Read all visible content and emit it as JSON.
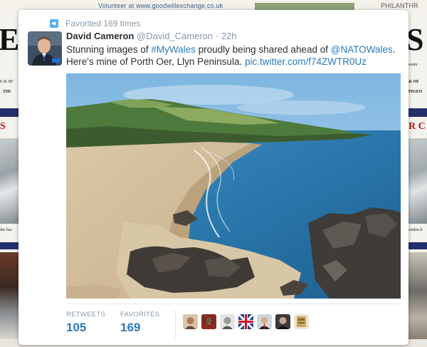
{
  "background": {
    "top_banner_text": "Volunteer at www.goodwillexchange.co.uk",
    "top_right_text": "PHILANTHR",
    "left_letter": "E",
    "right_letter": "S",
    "left_snippets": [
      "E & SP",
      "THI",
      "the bac"
    ],
    "right_snippets": [
      "asure ·",
      "& OF",
      "PIGEO",
      "ondon h"
    ],
    "left_red_letter": "S",
    "right_red_text": "R C"
  },
  "tweet": {
    "favorited_text": "Favorited 169 times",
    "author_name": "David Cameron",
    "author_handle": "@David_Cameron",
    "separator": "·",
    "time_ago": "22h",
    "text_part1": "Stunning images of ",
    "hashtag": "#MyWales",
    "text_part2": " proudly being shared ahead of ",
    "mention": "@NATOWales",
    "text_part3": ". Here's mine of Porth Oer, Llyn Peninsula. ",
    "pic_link": "pic.twitter.com/f74ZWTR0Uz",
    "photo_alt": "Porth Oer beach, Llyn Peninsula",
    "retweets_label": "RETWEETS",
    "retweets_count": "105",
    "favorites_label": "FAVORITES",
    "favorites_count": "169"
  },
  "colors": {
    "link": "#2b7bb9",
    "muted": "#8899a6",
    "text": "#292f33"
  }
}
